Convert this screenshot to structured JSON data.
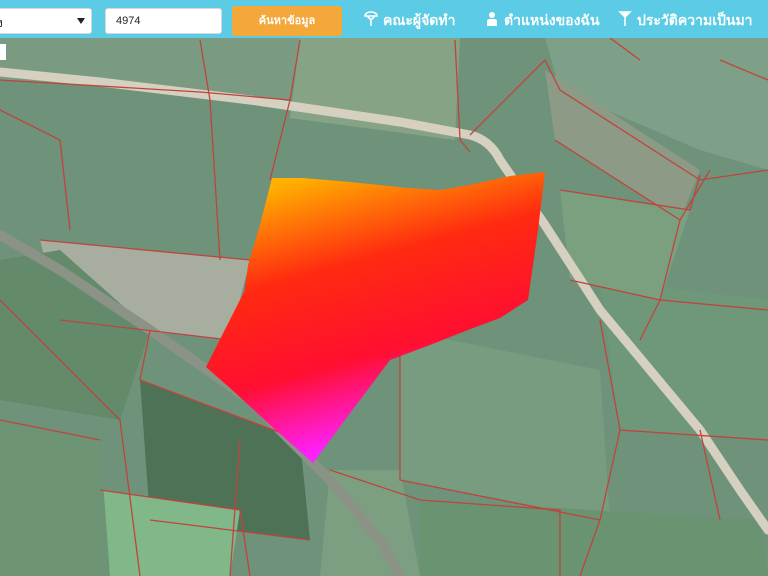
{
  "toolbar": {
    "select_value": "ง",
    "search_value": "4974",
    "search_button": "ค้นหาข้อมูล",
    "nav": [
      {
        "label": "คณะผู้จัดทำ",
        "icon": "pin-icon"
      },
      {
        "label": "ตำแหน่งของฉัน",
        "icon": "person-icon"
      },
      {
        "label": "ประวัติความเป็นมา",
        "icon": "pin-icon"
      }
    ]
  },
  "colors": {
    "topbar": "#5bcbe6",
    "button": "#f5a83a",
    "parcel_border": "#c0443c",
    "highlight_orange": "#ffb000",
    "highlight_red": "#ff1020",
    "highlight_magenta": "#ff20ff"
  }
}
